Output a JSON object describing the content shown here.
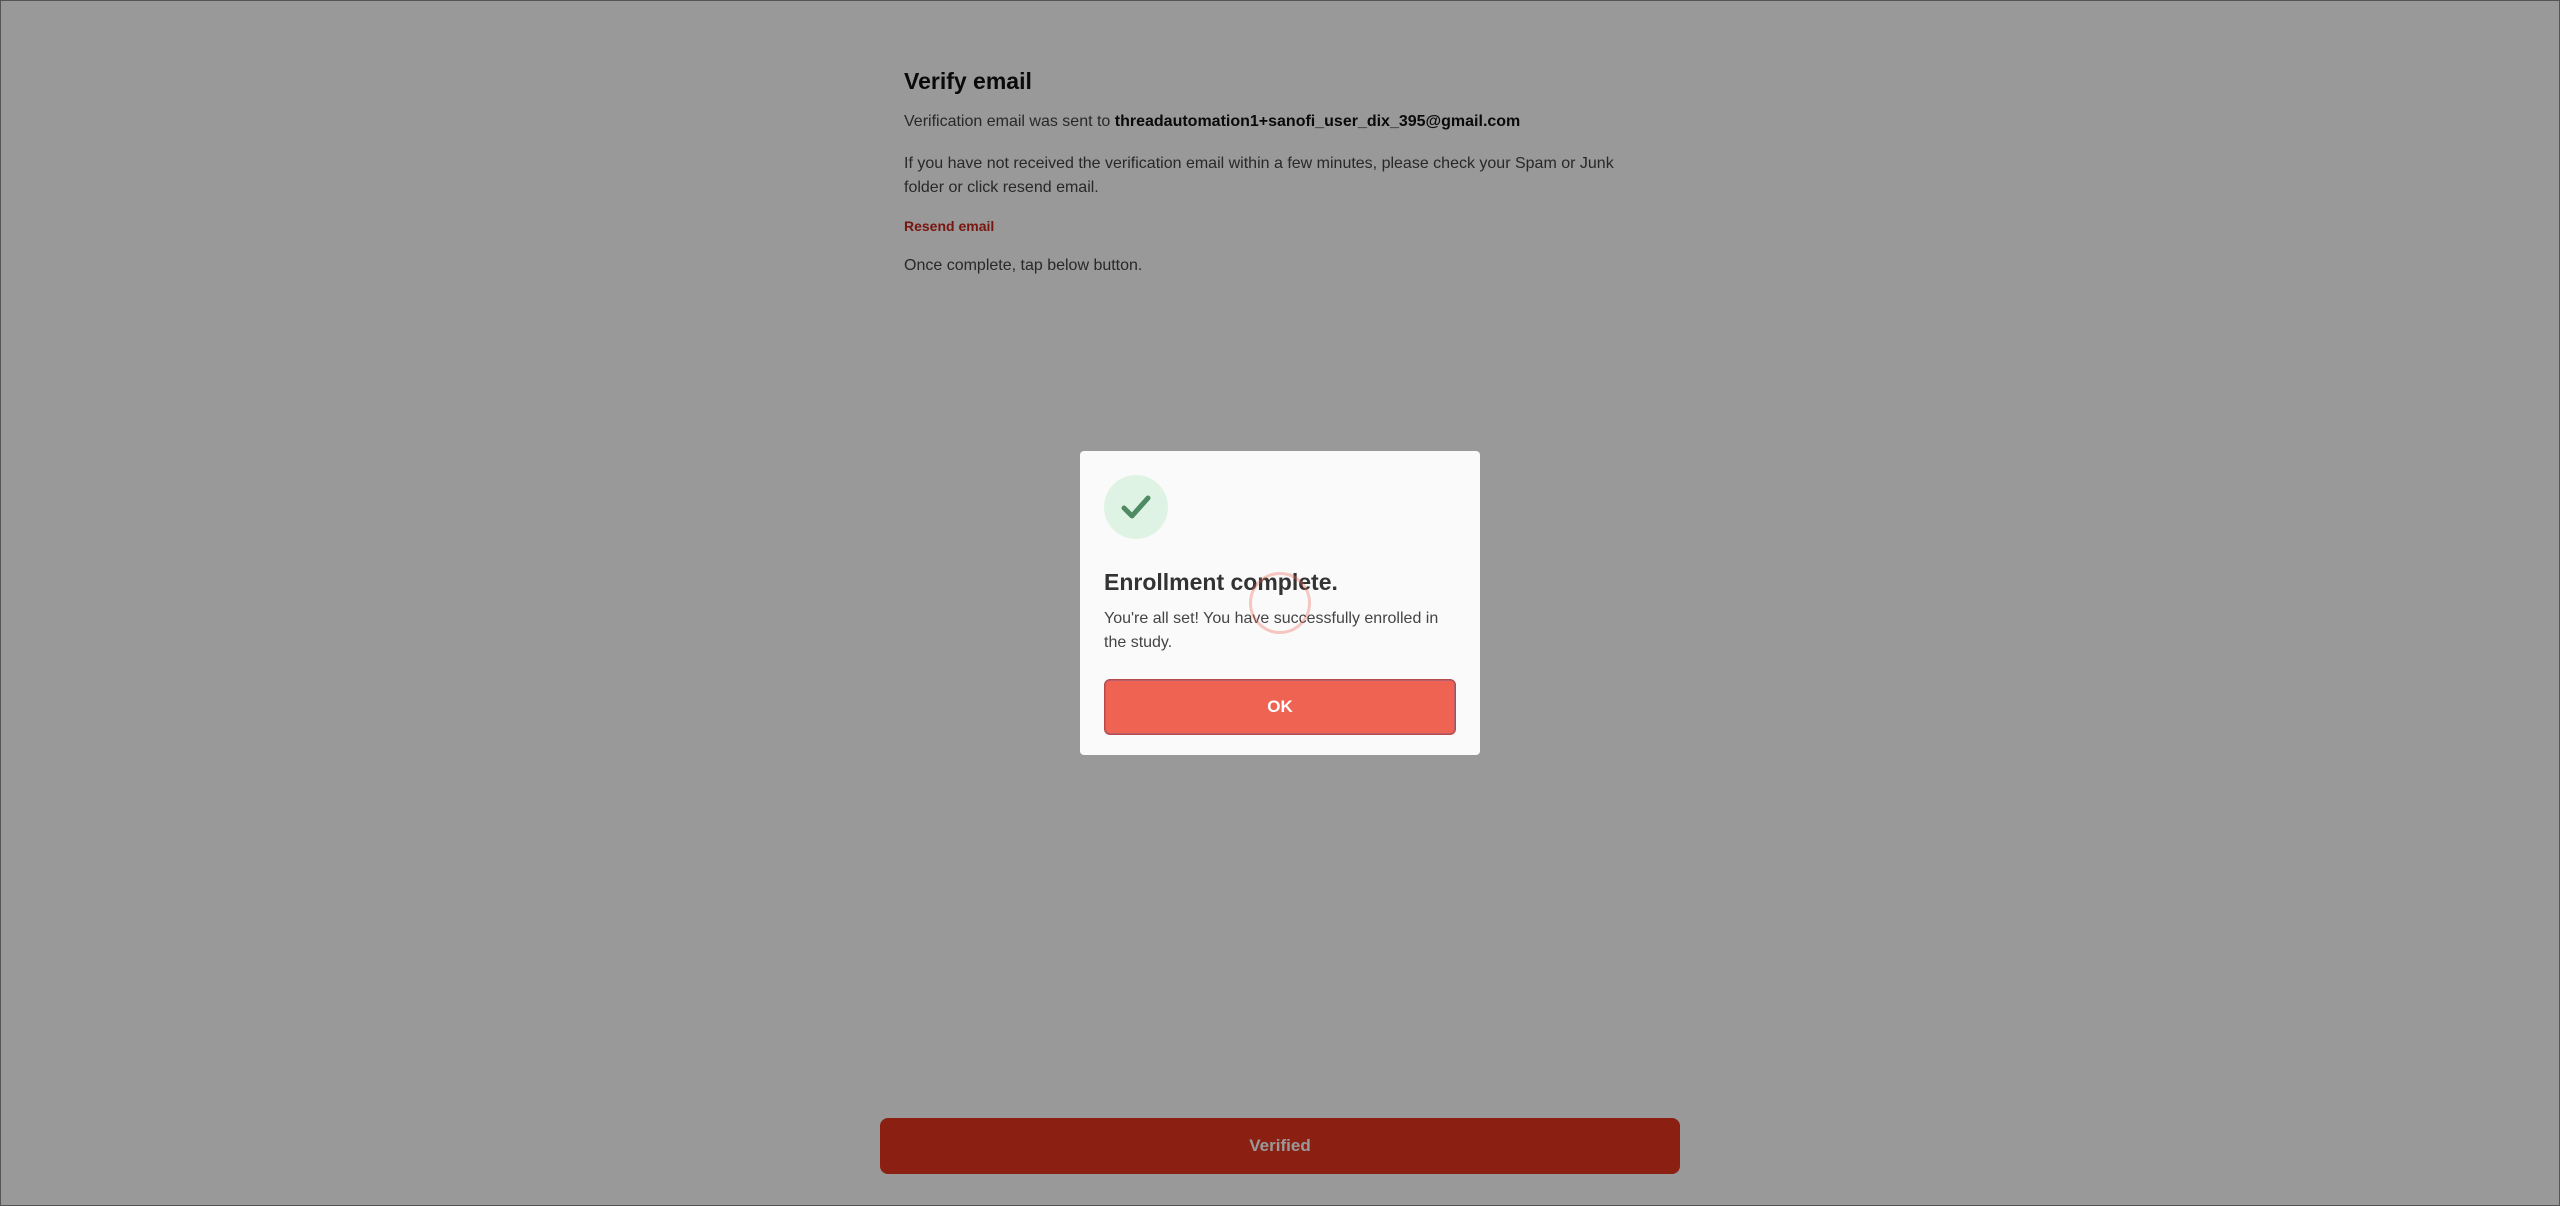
{
  "verify": {
    "title": "Verify email",
    "sent_prefix": "Verification email was sent to ",
    "email": "threadautomation1+sanofi_user_dix_395@gmail.com",
    "instructions": "If you have not received the verification email within a few minutes, please check your Spam or Junk folder or click resend email.",
    "resend_label": "Resend email",
    "complete_text": "Once complete, tap below button.",
    "verified_label": "Verified"
  },
  "modal": {
    "icon": "checkmark-icon",
    "title": "Enrollment complete.",
    "body": "You're all set! You have successfully enrolled in the study.",
    "ok_label": "OK"
  },
  "colors": {
    "primary_red": "#e8341f",
    "ok_button": "#ee6352",
    "link_red": "#c8261b",
    "success_bg": "#dff3e4",
    "success_check": "#4e8a62"
  }
}
